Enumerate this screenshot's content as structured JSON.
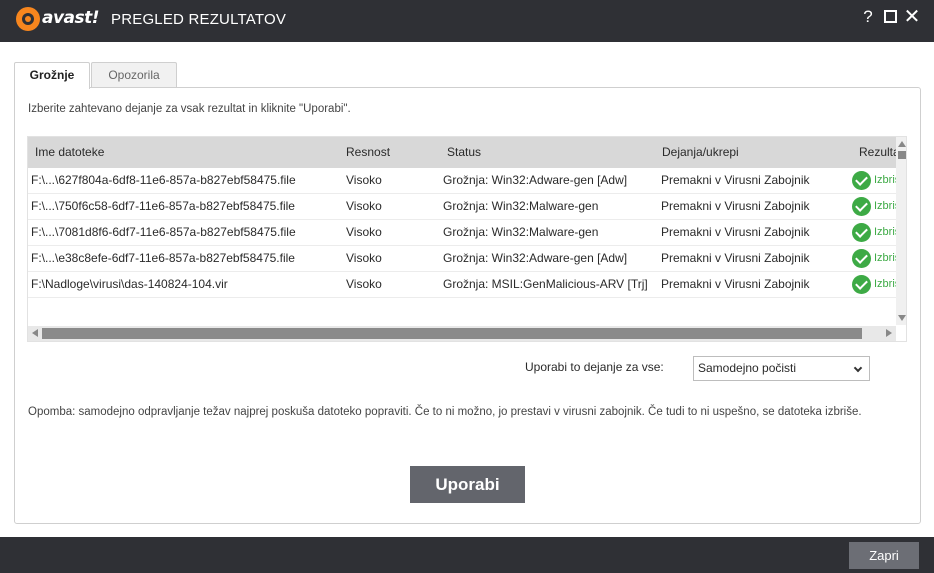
{
  "window": {
    "logo_text": "avast!",
    "title": "PREGLED REZULTATOV",
    "help_glyph": "?",
    "close_glyph": "✕"
  },
  "tabs": [
    {
      "label": "Grožnje",
      "active": true
    },
    {
      "label": "Opozorila",
      "active": false
    }
  ],
  "instruction": "Izberite zahtevano dejanje za vsak rezultat in kliknite \"Uporabi\".",
  "table": {
    "columns": [
      "Ime datoteke",
      "Resnost",
      "Status",
      "Dejanja/ukrepi",
      "Rezultat"
    ],
    "rows": [
      {
        "file": "F:\\...\\627f804a-6df8-11e6-857a-b827ebf58475.file",
        "severity": "Visoko",
        "status": "Grožnja: Win32:Adware-gen [Adw]",
        "action": "Premakni v Virusni Zabojnik",
        "result": "Izbrisano"
      },
      {
        "file": "F:\\...\\750f6c58-6df7-11e6-857a-b827ebf58475.file",
        "severity": "Visoko",
        "status": "Grožnja: Win32:Malware-gen",
        "action": "Premakni v Virusni Zabojnik",
        "result": "Izbrisano"
      },
      {
        "file": "F:\\...\\7081d8f6-6df7-11e6-857a-b827ebf58475.file",
        "severity": "Visoko",
        "status": "Grožnja: Win32:Malware-gen",
        "action": "Premakni v Virusni Zabojnik",
        "result": "Izbrisano"
      },
      {
        "file": "F:\\...\\e38c8efe-6df7-11e6-857a-b827ebf58475.file",
        "severity": "Visoko",
        "status": "Grožnja: Win32:Adware-gen [Adw]",
        "action": "Premakni v Virusni Zabojnik",
        "result": "Izbrisano"
      },
      {
        "file": "F:\\Nadloge\\virusi\\das-140824-104.vir",
        "severity": "Visoko",
        "status": "Grožnja: MSIL:GenMalicious-ARV [Trj]",
        "action": "Premakni v Virusni Zabojnik",
        "result": "Izbrisano"
      }
    ]
  },
  "apply_all": {
    "label": "Uporabi to dejanje za vse:",
    "selected": "Samodejno počisti"
  },
  "note": "Opomba: samodejno odpravljanje težav najprej poskuša datoteko popraviti. Če to ni možno, jo prestavi v virusni zabojnik. Če tudi to ni uspešno, se datoteka izbriše.",
  "buttons": {
    "apply": "Uporabi",
    "close": "Zapri"
  },
  "colors": {
    "titlebar": "#2f3035",
    "accent_orange": "#f7861e",
    "success_green": "#3daa45",
    "button_gray": "#63656c"
  },
  "icons": {
    "logo": "avast-ball-icon",
    "result": "check-circle-icon",
    "dropdown": "chevron-down-icon"
  }
}
